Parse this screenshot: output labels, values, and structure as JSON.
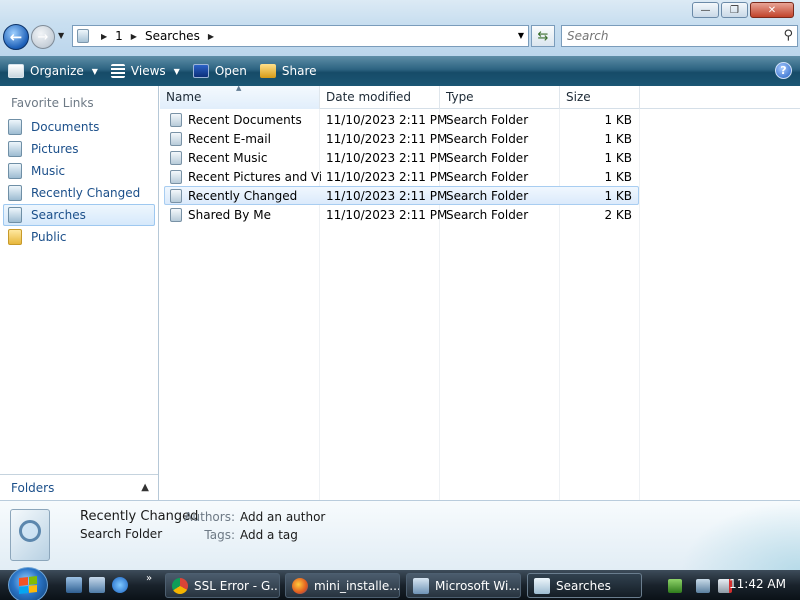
{
  "window": {
    "minimize": "—",
    "maximize": "❐",
    "close": "✕"
  },
  "address_bar": {
    "crumbs": [
      "1",
      "Searches"
    ]
  },
  "search": {
    "placeholder": "Search"
  },
  "command_bar": {
    "organize": "Organize",
    "views": "Views",
    "open": "Open",
    "share": "Share",
    "help": "?"
  },
  "nav_pane": {
    "favorites_title": "Favorite Links",
    "items": [
      {
        "label": "Documents",
        "icon": "documents-icon"
      },
      {
        "label": "Pictures",
        "icon": "pictures-icon"
      },
      {
        "label": "Music",
        "icon": "music-icon"
      },
      {
        "label": "Recently Changed",
        "icon": "recently-changed-icon"
      },
      {
        "label": "Searches",
        "icon": "searches-icon",
        "selected": true
      },
      {
        "label": "Public",
        "icon": "folder-icon"
      }
    ],
    "folders_label": "Folders"
  },
  "file_list": {
    "columns": [
      "Name",
      "Date modified",
      "Type",
      "Size"
    ],
    "rows": [
      {
        "name": "Recent Documents",
        "date": "11/10/2023 2:11 PM",
        "type": "Search Folder",
        "size": "1 KB"
      },
      {
        "name": "Recent E-mail",
        "date": "11/10/2023 2:11 PM",
        "type": "Search Folder",
        "size": "1 KB"
      },
      {
        "name": "Recent Music",
        "date": "11/10/2023 2:11 PM",
        "type": "Search Folder",
        "size": "1 KB"
      },
      {
        "name": "Recent Pictures and Vi...",
        "date": "11/10/2023 2:11 PM",
        "type": "Search Folder",
        "size": "1 KB"
      },
      {
        "name": "Recently Changed",
        "date": "11/10/2023 2:11 PM",
        "type": "Search Folder",
        "size": "1 KB",
        "selected": true
      },
      {
        "name": "Shared By Me",
        "date": "11/10/2023 2:11 PM",
        "type": "Search Folder",
        "size": "2 KB"
      }
    ]
  },
  "details_pane": {
    "name": "Recently Changed",
    "type": "Search Folder",
    "authors_label": "Authors:",
    "authors_value": "Add an author",
    "tags_label": "Tags:",
    "tags_value": "Add a tag"
  },
  "taskbar": {
    "more": "»",
    "tasks": [
      {
        "label": "SSL Error - G...",
        "icon": "chrome-icon"
      },
      {
        "label": "mini_installe...",
        "icon": "firefox-icon"
      },
      {
        "label": "Microsoft Wi...",
        "icon": "installer-icon"
      },
      {
        "label": "Searches",
        "icon": "search-folder-icon",
        "active": true
      }
    ],
    "clock": "11:42 AM"
  },
  "colors": {
    "accent": "#1b4f8a",
    "command_bar": "#1b5674",
    "selection": "#dbeafb"
  }
}
